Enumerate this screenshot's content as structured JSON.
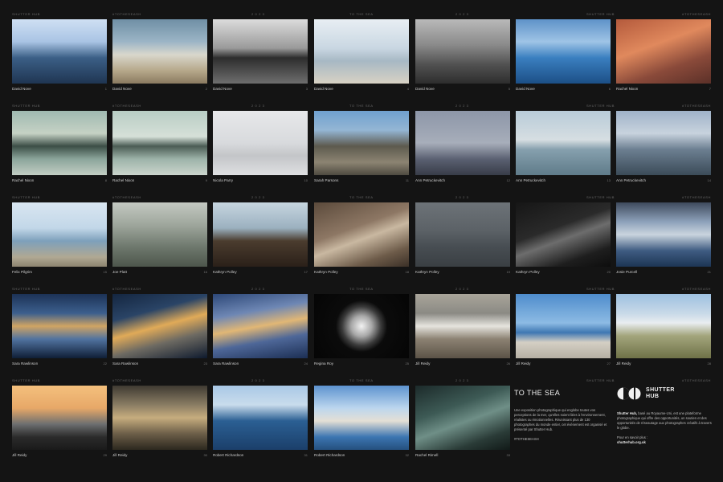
{
  "header_labels": [
    "SHUTTER HUB",
    "#TOTHESEASH",
    "2  0  2  3",
    "TO THE SEA",
    "2  0  2  3",
    "SHUTTER HUB",
    "#TOTHESEASH"
  ],
  "photos": [
    {
      "photographer": "David Nove",
      "number": "1",
      "tone": "linear-gradient(180deg,#cfe0f3 0%,#a9c4e4 35%,#3b5f86 60%,#1f3552 100%)"
    },
    {
      "photographer": "David Nove",
      "number": "2",
      "tone": "linear-gradient(180deg,#6f8fa5 0%,#9cb5c6 35%,#d9d7cc 55%,#b6a88a 80%,#8a7a60 100%)"
    },
    {
      "photographer": "David Nove",
      "number": "3",
      "tone": "linear-gradient(180deg,#dcdcdc 0%,#9a9a9a 45%,#2d2d2d 60%,#6e6e6e 100%)"
    },
    {
      "photographer": "David Nove",
      "number": "4",
      "tone": "linear-gradient(180deg,#e8eef3 0%,#c9d7e2 45%,#a7b8c4 65%,#d8d2c4 100%)"
    },
    {
      "photographer": "David Nove",
      "number": "5",
      "tone": "linear-gradient(180deg,#b9b9b9 0%,#8a8a8a 40%,#525252 70%,#2d2d2d 100%)"
    },
    {
      "photographer": "David Nove",
      "number": "6",
      "tone": "linear-gradient(180deg,#5e92c8 0%,#9fc4e6 35%,#3a7fc0 60%,#1c4f86 100%)"
    },
    {
      "photographer": "Rachel Nixon",
      "number": "7",
      "tone": "linear-gradient(160deg,#b45a3c 0%,#e0895d 40%,#8a4a3a 70%,#5b3028 100%)"
    },
    {
      "photographer": "Rachel Nixon",
      "number": "8",
      "tone": "linear-gradient(180deg,#9fb9b0 0%,#c6d2c5 35%,#3c4e46 55%,#8ba59b 75%,#c3ceC4 100%)"
    },
    {
      "photographer": "Rachel Nixon",
      "number": "9",
      "tone": "linear-gradient(180deg,#b8cdc4 0%,#d6e0d8 40%,#4b5c54 55%,#9db3a9 75%,#cbd5cc 100%)"
    },
    {
      "photographer": "Nicola Parry",
      "number": "10",
      "tone": "linear-gradient(180deg,#e7e8ea 0%,#d8dadd 50%,#c3c5c8 70%,#dfe0e2 100%)"
    },
    {
      "photographer": "Sarah Parsons",
      "number": "11",
      "tone": "linear-gradient(180deg,#6fa0cf 0%,#94b6d4 30%,#5d5a4e 55%,#8c8472 80%,#4e4a40 100%)"
    },
    {
      "photographer": "Ann Petruckevitch",
      "number": "12",
      "tone": "linear-gradient(180deg,#8d96a8 0%,#a7aeba 50%,#5b6172 75%,#383c48 100%)"
    },
    {
      "photographer": "Ann Petruckevitch",
      "number": "13",
      "tone": "linear-gradient(180deg,#b8cbd8 0%,#d6dee2 45%,#86a0ae 60%,#5f7b89 100%)"
    },
    {
      "photographer": "Ann Petruckevitch",
      "number": "14",
      "tone": "linear-gradient(180deg,#9fb2c8 0%,#c8d3de 35%,#6c7f91 60%,#3b4b58 100%)"
    },
    {
      "photographer": "Felix Pilgrim",
      "number": "15",
      "tone": "linear-gradient(180deg,#d9e6f1 0%,#c2d7e8 40%,#7ea0bb 60%,#b0a893 85%,#8d8470 100%)"
    },
    {
      "photographer": "Joe Platt",
      "number": "16",
      "tone": "linear-gradient(180deg,#c4c9c2 0%,#9ea69c 35%,#6d776c 70%,#4d564c 100%)"
    },
    {
      "photographer": "Kathryn Polley",
      "number": "17",
      "tone": "linear-gradient(180deg,#c7d6e0 0%,#9bb0bf 40%,#4b3c2e 60%,#2b2019 100%)"
    },
    {
      "photographer": "Kathryn Polley",
      "number": "18",
      "tone": "linear-gradient(160deg,#5b4a3b 0%,#8d7764 40%,#c9b8a1 55%,#6d5b49 80%,#3b3027 100%)"
    },
    {
      "photographer": "Kathryn Polley",
      "number": "19",
      "tone": "linear-gradient(180deg,#6d7378 0%,#5b6166 45%,#474d52 70%,#3a3f43 100%)"
    },
    {
      "photographer": "Kathryn Polley",
      "number": "20",
      "tone": "linear-gradient(160deg,#161616 0%,#2a2a2a 40%,#6d6d6d 55%,#1e1e1e 80%,#0d0d0d 100%)"
    },
    {
      "photographer": "Josie Purcell",
      "number": "21",
      "tone": "linear-gradient(180deg,#3e4a5c 0%,#8da1ba 30%,#c9d4de 50%,#3f5c82 75%,#1d3554 100%)"
    },
    {
      "photographer": "Sara Rawlinson",
      "number": "22",
      "tone": "linear-gradient(180deg,#1c3256 0%,#3c5f8d 30%,#d0a463 50%,#5173a0 70%,#0f1e36 100%)"
    },
    {
      "photographer": "Sara Rawlinson",
      "number": "23",
      "tone": "linear-gradient(165deg,#142640 0%,#2a4466 30%,#e0aa58 50%,#6d6a62 70%,#0e1a2e 100%)"
    },
    {
      "photographer": "Sara Rawlinson",
      "number": "24",
      "tone": "linear-gradient(170deg,#2d4878 0%,#6e87b4 30%,#e1b775 50%,#4e6798 70%,#1c2f54 100%)"
    },
    {
      "photographer": "Regina Roy",
      "number": "25",
      "tone": "radial-gradient(circle at 50% 50%,#f2f2f2 0%,#a8a8a8 18%,#3a3a3a 34%,#0b0b0b 45%,#050505 100%)"
    },
    {
      "photographer": "Jill Reidy",
      "number": "26",
      "tone": "linear-gradient(180deg,#a9a59a 0%,#8b8a84 30%,#e6e4de 50%,#8c8273 70%,#5c5347 100%)"
    },
    {
      "photographer": "Jill Reidy",
      "number": "27",
      "tone": "linear-gradient(180deg,#4e8ccc 0%,#8dbbe4 45%,#3e77b2 60%,#d4cfc4 75%,#b6b0a4 100%)"
    },
    {
      "photographer": "Jill Reidy",
      "number": "28",
      "tone": "linear-gradient(180deg,#9dc0e0 0%,#c8d9e8 30%,#e9edf0 45%,#a3a57c 65%,#6f7248 100%)"
    },
    {
      "photographer": "Jill Reidy",
      "number": "29",
      "tone": "linear-gradient(180deg,#f4c07d 0%,#e7a868 35%,#6d6f70 60%,#2b2b2b 80%,#1a1a1a 100%)"
    },
    {
      "photographer": "Jill Reidy",
      "number": "30",
      "tone": "linear-gradient(180deg,#3f3a32 0%,#8a7d63 30%,#c6ad7e 50%,#6c5e48 75%,#2c281f 100%)"
    },
    {
      "photographer": "Robert Richardson",
      "number": "31",
      "tone": "linear-gradient(180deg,#a9c8e6 0%,#c9dcec 30%,#2b5f93 55%,#1b3f6a 100%)"
    },
    {
      "photographer": "Robert Richardson",
      "number": "32",
      "tone": "linear-gradient(180deg,#5d93cf 0%,#bcd6ee 35%,#e4dfd5 55%,#3c75b1 80%,#25507e 100%)"
    },
    {
      "photographer": "Rachel Rimell",
      "number": "33",
      "tone": "linear-gradient(160deg,#1c2a2a 0%,#3d5a55 35%,#6f8f87 55%,#2a3b37 80%,#111a18 100%)"
    }
  ],
  "info": {
    "title": "TO THE SEA",
    "description": "Une exposition photographique qui englobe toutes vos perceptions de la mer, qu'elles soient liées à l'environnement, réalistes ou émotionnelles. Réunissant plus de 130 photographes du monde entier, cet évènement est organisé et présenté par Shutter Hub.",
    "hashtag": "#TOTHESEASH"
  },
  "brand": {
    "logo_line1": "SHUTTER",
    "logo_line2": "HUB",
    "about_bold": "Shutter Hub,",
    "about": " basé au Royaume-Uni, est une plateforme photographique qui offre des opportunités, un soutien et des opportunités de réseautage aux photographes créatifs à travers le globe.",
    "more_label": "Pour en savoir plus :",
    "website": "shutterhub.org.uk"
  },
  "colors": {
    "background": "#141414",
    "text": "#d8d8d8",
    "muted": "#6a6a6a"
  }
}
